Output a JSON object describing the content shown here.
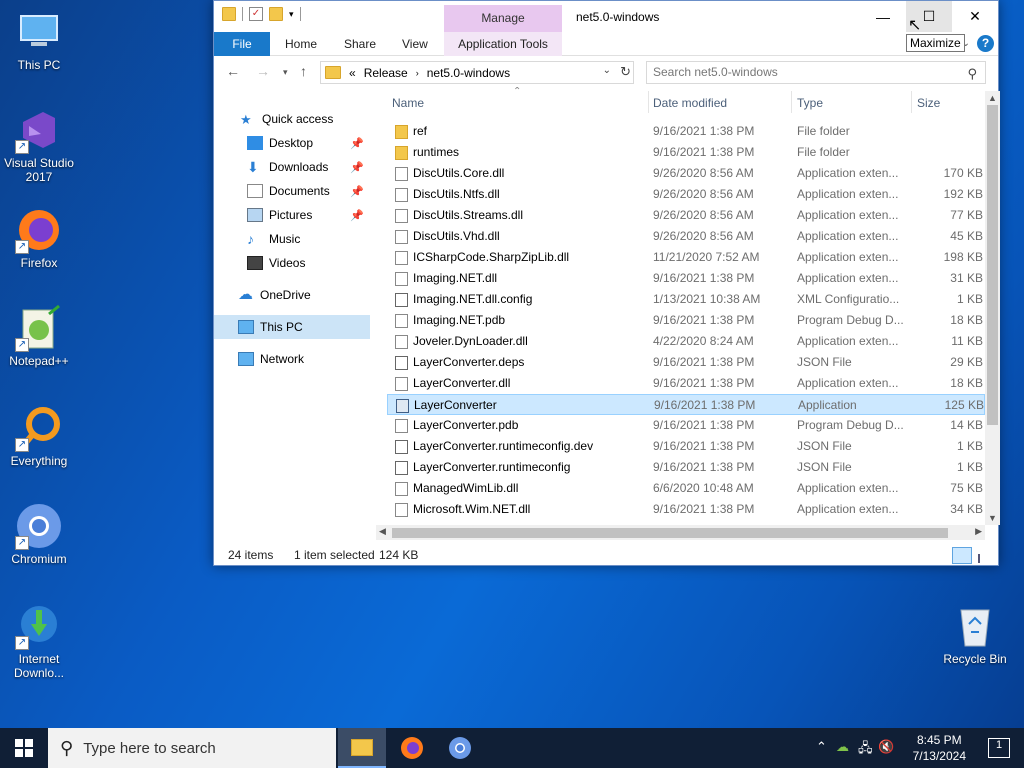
{
  "desktop": {
    "icons": [
      {
        "label": "This PC"
      },
      {
        "label": "Visual Studio 2017"
      },
      {
        "label": "Firefox"
      },
      {
        "label": "Notepad++"
      },
      {
        "label": "Everything"
      },
      {
        "label": "Chromium"
      },
      {
        "label": "Internet Downlo..."
      },
      {
        "label": "Recycle Bin"
      }
    ]
  },
  "window": {
    "title": "net5.0-windows",
    "manage_tab": "Manage",
    "tooltip": "Maximize",
    "ribbon_tabs": [
      "File",
      "Home",
      "Share",
      "View",
      "Application Tools"
    ],
    "address": {
      "sep": "«",
      "crumbs": [
        "Release",
        "net5.0-windows"
      ]
    },
    "search_placeholder": "Search net5.0-windows",
    "nav": {
      "quick_access": "Quick access",
      "desktop": "Desktop",
      "downloads": "Downloads",
      "documents": "Documents",
      "pictures": "Pictures",
      "music": "Music",
      "videos": "Videos",
      "onedrive": "OneDrive",
      "thispc": "This PC",
      "network": "Network"
    },
    "columns": [
      "Name",
      "Date modified",
      "Type",
      "Size"
    ],
    "files": [
      {
        "name": "ref",
        "date": "9/16/2021 1:38 PM",
        "type": "File folder",
        "size": "",
        "kind": "folder"
      },
      {
        "name": "runtimes",
        "date": "9/16/2021 1:38 PM",
        "type": "File folder",
        "size": "",
        "kind": "folder"
      },
      {
        "name": "DiscUtils.Core.dll",
        "date": "9/26/2020 8:56 AM",
        "type": "Application exten...",
        "size": "170 KB",
        "kind": "dll"
      },
      {
        "name": "DiscUtils.Ntfs.dll",
        "date": "9/26/2020 8:56 AM",
        "type": "Application exten...",
        "size": "192 KB",
        "kind": "dll"
      },
      {
        "name": "DiscUtils.Streams.dll",
        "date": "9/26/2020 8:56 AM",
        "type": "Application exten...",
        "size": "77 KB",
        "kind": "dll"
      },
      {
        "name": "DiscUtils.Vhd.dll",
        "date": "9/26/2020 8:56 AM",
        "type": "Application exten...",
        "size": "45 KB",
        "kind": "dll"
      },
      {
        "name": "ICSharpCode.SharpZipLib.dll",
        "date": "11/21/2020 7:52 AM",
        "type": "Application exten...",
        "size": "198 KB",
        "kind": "dll"
      },
      {
        "name": "Imaging.NET.dll",
        "date": "9/16/2021 1:38 PM",
        "type": "Application exten...",
        "size": "31 KB",
        "kind": "dll"
      },
      {
        "name": "Imaging.NET.dll.config",
        "date": "1/13/2021 10:38 AM",
        "type": "XML Configuratio...",
        "size": "1 KB",
        "kind": "cfg"
      },
      {
        "name": "Imaging.NET.pdb",
        "date": "9/16/2021 1:38 PM",
        "type": "Program Debug D...",
        "size": "18 KB",
        "kind": "dll"
      },
      {
        "name": "Joveler.DynLoader.dll",
        "date": "4/22/2020 8:24 AM",
        "type": "Application exten...",
        "size": "11 KB",
        "kind": "dll"
      },
      {
        "name": "LayerConverter.deps",
        "date": "9/16/2021 1:38 PM",
        "type": "JSON File",
        "size": "29 KB",
        "kind": "cfg"
      },
      {
        "name": "LayerConverter.dll",
        "date": "9/16/2021 1:38 PM",
        "type": "Application exten...",
        "size": "18 KB",
        "kind": "dll"
      },
      {
        "name": "LayerConverter",
        "date": "9/16/2021 1:38 PM",
        "type": "Application",
        "size": "125 KB",
        "kind": "app",
        "selected": true
      },
      {
        "name": "LayerConverter.pdb",
        "date": "9/16/2021 1:38 PM",
        "type": "Program Debug D...",
        "size": "14 KB",
        "kind": "dll"
      },
      {
        "name": "LayerConverter.runtimeconfig.dev",
        "date": "9/16/2021 1:38 PM",
        "type": "JSON File",
        "size": "1 KB",
        "kind": "cfg"
      },
      {
        "name": "LayerConverter.runtimeconfig",
        "date": "9/16/2021 1:38 PM",
        "type": "JSON File",
        "size": "1 KB",
        "kind": "cfg"
      },
      {
        "name": "ManagedWimLib.dll",
        "date": "6/6/2020 10:48 AM",
        "type": "Application exten...",
        "size": "75 KB",
        "kind": "dll"
      },
      {
        "name": "Microsoft.Wim.NET.dll",
        "date": "9/16/2021 1:38 PM",
        "type": "Application exten...",
        "size": "34 KB",
        "kind": "dll"
      }
    ],
    "status": {
      "items": "24 items",
      "selected": "1 item selected",
      "size": "124 KB"
    }
  },
  "taskbar": {
    "search_placeholder": "Type here to search",
    "time": "8:45 PM",
    "date": "7/13/2024",
    "notification_count": "1"
  }
}
